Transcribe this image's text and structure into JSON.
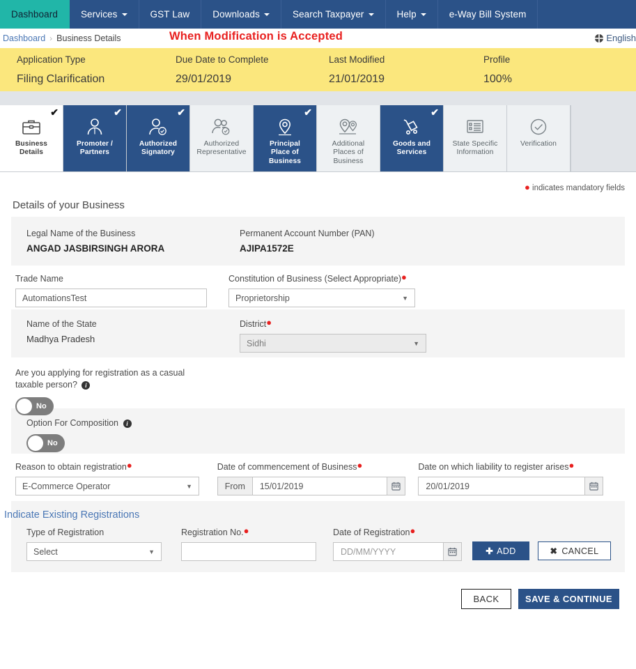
{
  "topnav": {
    "items": [
      {
        "label": "Dashboard",
        "caret": false,
        "active": true
      },
      {
        "label": "Services",
        "caret": true,
        "active": false
      },
      {
        "label": "GST Law",
        "caret": false,
        "active": false
      },
      {
        "label": "Downloads",
        "caret": true,
        "active": false
      },
      {
        "label": "Search Taxpayer",
        "caret": true,
        "active": false
      },
      {
        "label": "Help",
        "caret": true,
        "active": false
      },
      {
        "label": "e-Way Bill System",
        "caret": false,
        "active": false
      }
    ]
  },
  "breadcrumb": {
    "root": "Dashboard",
    "separator": "›",
    "current": "Business Details"
  },
  "annotation": "When Modification is Accepted",
  "language": {
    "label": "English",
    "icon": "globe-icon"
  },
  "summary": {
    "labels": [
      "Application Type",
      "Due Date to Complete",
      "Last Modified",
      "Profile"
    ],
    "values": [
      "Filing Clarification",
      "29/01/2019",
      "21/01/2019",
      "100%"
    ]
  },
  "steps": [
    {
      "label": "Business\nDetails",
      "icon": "briefcase-icon",
      "state": "current",
      "tick": true
    },
    {
      "label": "Promoter /\nPartners",
      "icon": "person-icon",
      "state": "done",
      "tick": true
    },
    {
      "label": "Authorized\nSignatory",
      "icon": "person-check-icon",
      "state": "done",
      "tick": true
    },
    {
      "label": "Authorized\nRepresentative",
      "icon": "people-check-icon",
      "state": "todo",
      "tick": false
    },
    {
      "label": "Principal\nPlace of\nBusiness",
      "icon": "map-pin-icon",
      "state": "done",
      "tick": true
    },
    {
      "label": "Additional\nPlaces of\nBusiness",
      "icon": "map-pins-icon",
      "state": "todo",
      "tick": false
    },
    {
      "label": "Goods and\nServices",
      "icon": "handtruck-icon",
      "state": "done",
      "tick": true
    },
    {
      "label": "State Specific\nInformation",
      "icon": "list-card-icon",
      "state": "todo",
      "tick": false
    },
    {
      "label": "Verification",
      "icon": "check-circle-icon",
      "state": "todo",
      "tick": false
    }
  ],
  "mandatory_note": "indicates mandatory fields",
  "business": {
    "section_title": "Details of your Business",
    "legal_name_label": "Legal Name of the Business",
    "legal_name_value": "ANGAD JASBIRSINGH ARORA",
    "pan_label": "Permanent Account Number (PAN)",
    "pan_value": "AJIPA1572E",
    "trade_name_label": "Trade Name",
    "trade_name_value": "AutomationsTest",
    "constitution_label": "Constitution of Business (Select Appropriate)",
    "constitution_value": "Proprietorship",
    "state_label": "Name of the State",
    "state_value": "Madhya Pradesh",
    "district_label": "District",
    "district_value": "Sidhi"
  },
  "casual": {
    "question": "Are you applying for registration as a casual taxable person?",
    "toggle_value": "No"
  },
  "composition": {
    "label": "Option For Composition",
    "toggle_value": "No"
  },
  "registration_row": {
    "reason_label": "Reason to obtain registration",
    "reason_value": "E-Commerce Operator",
    "commencement_label": "Date of commencement of Business",
    "commencement_prefix": "From",
    "commencement_value": "15/01/2019",
    "liability_label": "Date on which liability to register arises",
    "liability_value": "20/01/2019"
  },
  "existing": {
    "title": "Indicate Existing Registrations",
    "type_label": "Type of Registration",
    "type_value": "Select",
    "regno_label": "Registration No.",
    "regno_value": "",
    "regno_placeholder": "",
    "date_label": "Date of Registration",
    "date_placeholder": "DD/MM/YYYY",
    "add_label": "ADD",
    "cancel_label": "CANCEL"
  },
  "footer": {
    "back_label": "BACK",
    "save_label": "SAVE & CONTINUE"
  },
  "colors": {
    "navy": "#2b5288",
    "teal": "#21b6a8",
    "yellow": "#fbe77d",
    "required_red": "#e8201f",
    "annotation_red": "#e8201f",
    "link_blue": "#4a77b5"
  }
}
